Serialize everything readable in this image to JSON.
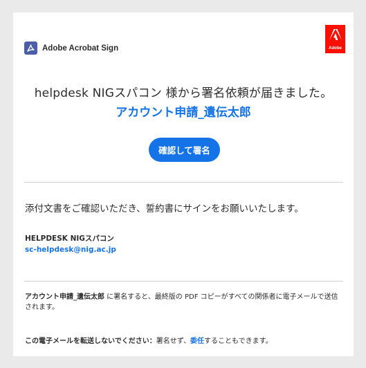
{
  "header": {
    "brand": "Adobe Acrobat Sign",
    "adobe_badge_text": "Adobe"
  },
  "main": {
    "headline": "helpdesk NIGスパコン 様から署名依頼が届きました。",
    "document_name": "アカウント申請_遺伝太郎",
    "cta_label": "確認して署名",
    "message": "添付文書をご確認いただき、誓約書にサインをお願いいたします。",
    "sender_name": "HELPDESK NIGスパコン",
    "sender_email": "sc-helpdesk@nig.ac.jp"
  },
  "footer": {
    "notice_doc": "アカウント申請_遺伝太郎",
    "notice_rest": " に署名すると、最終版の PDF コピーがすべての関係者に電子メールで送信されます。",
    "forward_bold": "この電子メールを転送しないでください：",
    "forward_mid": "署名せず、",
    "forward_link": "委任",
    "forward_end": "することもできます。"
  },
  "colors": {
    "accent": "#1473e6",
    "adobe_red": "#fa0f00",
    "acrobat_logo": "#4d5ea8",
    "background": "#eaeaea"
  },
  "icons": {
    "acrobat": "acrobat-sign-logo-icon",
    "adobe": "adobe-logo-icon"
  }
}
